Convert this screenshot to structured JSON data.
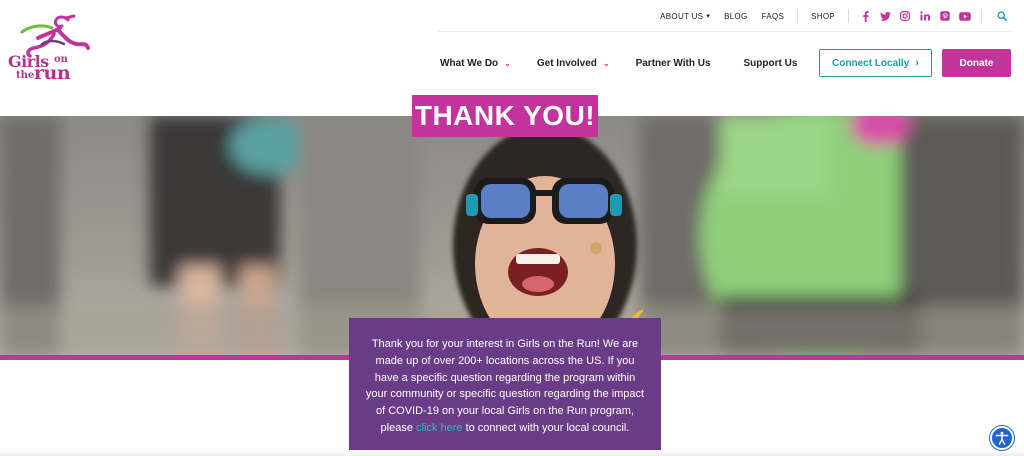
{
  "brand": {
    "logo_words": [
      "Girls",
      "on",
      "the",
      "run"
    ],
    "primary_color": "#c2349b",
    "teal_color": "#1aa19a",
    "purple_color": "#6a3c87"
  },
  "utility_nav": {
    "items": [
      "ABOUT US",
      "BLOG",
      "FAQS",
      "SHOP"
    ],
    "social_icons": [
      "facebook-icon",
      "twitter-icon",
      "instagram-icon",
      "linkedin-icon",
      "pinterest-icon",
      "youtube-icon"
    ]
  },
  "main_nav": {
    "items": [
      {
        "label": "What We Do",
        "has_dropdown": true
      },
      {
        "label": "Get Involved",
        "has_dropdown": true
      },
      {
        "label": "Partner With Us",
        "has_dropdown": false
      },
      {
        "label": "Support Us",
        "has_dropdown": false
      }
    ],
    "connect_label": "Connect Locally",
    "donate_label": "Donate"
  },
  "hero": {
    "title": "THANK YOU!"
  },
  "message": {
    "text_before_link": "Thank you for your interest in Girls on the Run! We are made up of over 200+ locations across the US. If you have a specific question regarding the program within your community or specific question regarding the impact of COVID-19 on your local Girls on the Run program, please",
    "link_text": "click here",
    "text_after_link": "to connect with your local council."
  }
}
